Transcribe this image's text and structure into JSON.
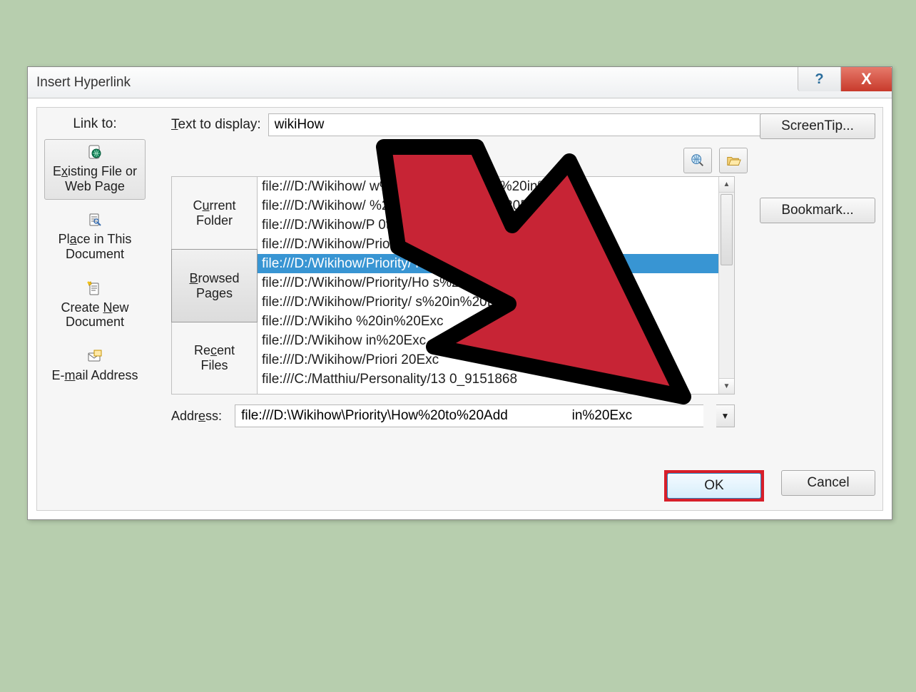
{
  "dialog": {
    "title": "Insert Hyperlink",
    "link_to_label": "Link to:",
    "text_to_display_label": "Text to display:",
    "text_to_display_value": "wikiHow",
    "address_label": "Address:",
    "address_value": "file:///D:\\Wikihow\\Priority\\How%20to%20Add                 in%20Exc",
    "buttons": {
      "screen_tip": "ScreenTip...",
      "bookmark": "Bookmark...",
      "ok": "OK",
      "cancel": "Cancel"
    },
    "link_to_items": [
      {
        "label_html": "Existing File or Web Page",
        "icon": "globe-page-icon"
      },
      {
        "label_html": "Place in This Document",
        "icon": "doc-place-icon"
      },
      {
        "label_html": "Create New Document",
        "icon": "new-doc-icon"
      },
      {
        "label_html": "E-mail Address",
        "icon": "email-icon"
      }
    ],
    "folder_tabs": [
      {
        "label": "Current Folder"
      },
      {
        "label": "Browsed Pages",
        "selected": true
      },
      {
        "label": "Recent Files"
      }
    ],
    "file_list": [
      "file:///D:/Wikihow/                 w%20to%2           %20Links%20in%20Exc",
      "file:///D:/Wikihow/                  %20to%              Links%20in%20Exc",
      "file:///D:/Wikihow/P                  0to%               0Links%20in%20Exc",
      "file:///D:/Wikihow/Prio                                    Links%20in%20Exc",
      "file:///D:/Wikihow/Priority/                                 nks%20in%20Ex",
      "file:///D:/Wikihow/Priority/Ho                                s%20in%20Exc",
      "file:///D:/Wikihow/Priority/                                  s%20in%20Exc",
      "file:///D:/Wikiho                                            %20in%20Exc",
      "file:///D:/Wikihow                                             in%20Exc",
      "file:///D:/Wikihow/Priori                                        20Exc",
      "file:///C:/Matthiu/Personality/13                               0_9151868"
    ],
    "file_list_selected_index": 4
  }
}
